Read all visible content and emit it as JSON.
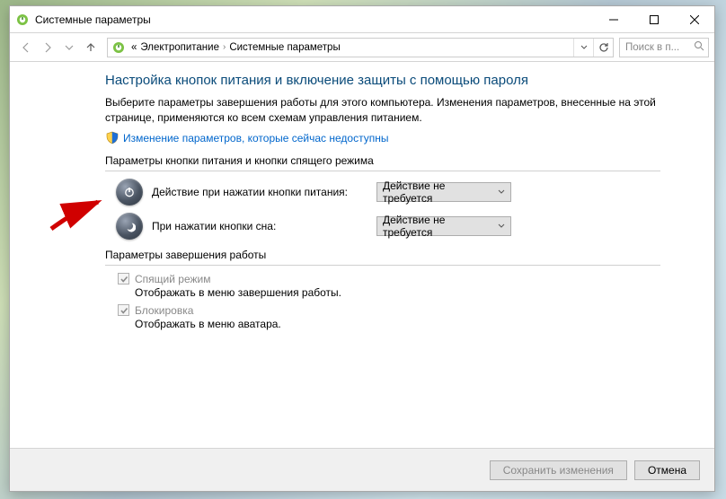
{
  "window": {
    "title": "Системные параметры"
  },
  "breadcrumb": {
    "item1": "Электропитание",
    "item2": "Системные параметры"
  },
  "search": {
    "placeholder": "Поиск в п..."
  },
  "page": {
    "heading": "Настройка кнопок питания и включение защиты с помощью пароля",
    "description": "Выберите параметры завершения работы для этого компьютера. Изменения параметров, внесенные на этой странице, применяются ко всем схемам управления питанием.",
    "uac_link": "Изменение параметров, которые сейчас недоступны"
  },
  "section1": {
    "title": "Параметры кнопки питания и кнопки спящего режима",
    "power_label": "Действие при нажатии кнопки питания:",
    "power_value": "Действие не требуется",
    "sleep_label": "При нажатии кнопки сна:",
    "sleep_value": "Действие не требуется"
  },
  "section2": {
    "title": "Параметры завершения работы",
    "sleep": {
      "label": "Спящий режим",
      "sub": "Отображать в меню завершения работы."
    },
    "lock": {
      "label": "Блокировка",
      "sub": "Отображать в меню аватара."
    }
  },
  "footer": {
    "save": "Сохранить изменения",
    "cancel": "Отмена"
  }
}
